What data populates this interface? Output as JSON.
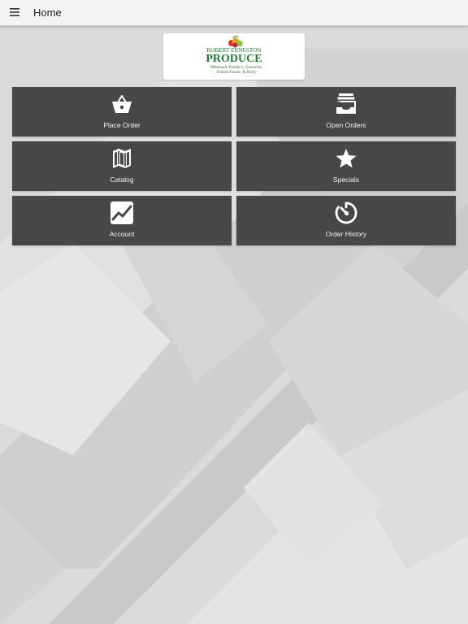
{
  "appbar": {
    "title": "Home",
    "menu_icon": "menu-icon"
  },
  "logo": {
    "line1": "ROBERT ERNESTON",
    "line2": "PRODUCE",
    "line3": "Wholesale Produce, Groceries,",
    "line4": "Frozen Foods, & Dairy",
    "green": "#1e7a2e"
  },
  "tiles": [
    {
      "label": "Place Order",
      "icon": "basket-icon"
    },
    {
      "label": "Open Orders",
      "icon": "inbox-icon"
    },
    {
      "label": "Catalog",
      "icon": "map-icon"
    },
    {
      "label": "Specials",
      "icon": "star-icon"
    },
    {
      "label": "Account",
      "icon": "chart-icon"
    },
    {
      "label": "Order History",
      "icon": "timer-icon"
    }
  ],
  "colors": {
    "tile": "#474649",
    "appbar": "#f4f4f4",
    "background": "#d9d9db"
  }
}
